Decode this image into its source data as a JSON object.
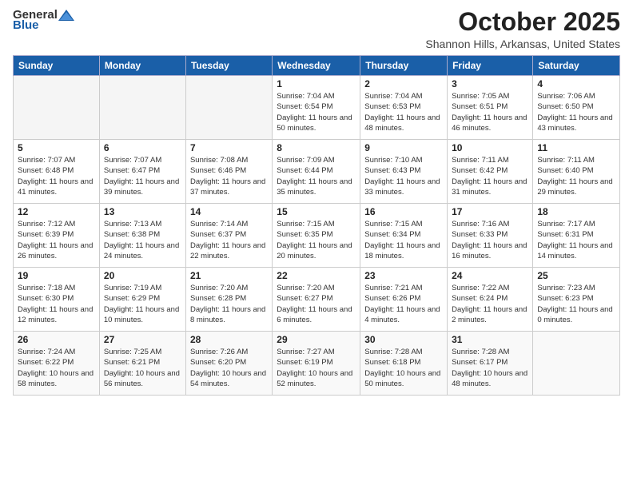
{
  "header": {
    "logo_general": "General",
    "logo_blue": "Blue",
    "month": "October 2025",
    "location": "Shannon Hills, Arkansas, United States"
  },
  "weekdays": [
    "Sunday",
    "Monday",
    "Tuesday",
    "Wednesday",
    "Thursday",
    "Friday",
    "Saturday"
  ],
  "weeks": [
    [
      {
        "day": "",
        "info": ""
      },
      {
        "day": "",
        "info": ""
      },
      {
        "day": "",
        "info": ""
      },
      {
        "day": "1",
        "info": "Sunrise: 7:04 AM\nSunset: 6:54 PM\nDaylight: 11 hours\nand 50 minutes."
      },
      {
        "day": "2",
        "info": "Sunrise: 7:04 AM\nSunset: 6:53 PM\nDaylight: 11 hours\nand 48 minutes."
      },
      {
        "day": "3",
        "info": "Sunrise: 7:05 AM\nSunset: 6:51 PM\nDaylight: 11 hours\nand 46 minutes."
      },
      {
        "day": "4",
        "info": "Sunrise: 7:06 AM\nSunset: 6:50 PM\nDaylight: 11 hours\nand 43 minutes."
      }
    ],
    [
      {
        "day": "5",
        "info": "Sunrise: 7:07 AM\nSunset: 6:48 PM\nDaylight: 11 hours\nand 41 minutes."
      },
      {
        "day": "6",
        "info": "Sunrise: 7:07 AM\nSunset: 6:47 PM\nDaylight: 11 hours\nand 39 minutes."
      },
      {
        "day": "7",
        "info": "Sunrise: 7:08 AM\nSunset: 6:46 PM\nDaylight: 11 hours\nand 37 minutes."
      },
      {
        "day": "8",
        "info": "Sunrise: 7:09 AM\nSunset: 6:44 PM\nDaylight: 11 hours\nand 35 minutes."
      },
      {
        "day": "9",
        "info": "Sunrise: 7:10 AM\nSunset: 6:43 PM\nDaylight: 11 hours\nand 33 minutes."
      },
      {
        "day": "10",
        "info": "Sunrise: 7:11 AM\nSunset: 6:42 PM\nDaylight: 11 hours\nand 31 minutes."
      },
      {
        "day": "11",
        "info": "Sunrise: 7:11 AM\nSunset: 6:40 PM\nDaylight: 11 hours\nand 29 minutes."
      }
    ],
    [
      {
        "day": "12",
        "info": "Sunrise: 7:12 AM\nSunset: 6:39 PM\nDaylight: 11 hours\nand 26 minutes."
      },
      {
        "day": "13",
        "info": "Sunrise: 7:13 AM\nSunset: 6:38 PM\nDaylight: 11 hours\nand 24 minutes."
      },
      {
        "day": "14",
        "info": "Sunrise: 7:14 AM\nSunset: 6:37 PM\nDaylight: 11 hours\nand 22 minutes."
      },
      {
        "day": "15",
        "info": "Sunrise: 7:15 AM\nSunset: 6:35 PM\nDaylight: 11 hours\nand 20 minutes."
      },
      {
        "day": "16",
        "info": "Sunrise: 7:15 AM\nSunset: 6:34 PM\nDaylight: 11 hours\nand 18 minutes."
      },
      {
        "day": "17",
        "info": "Sunrise: 7:16 AM\nSunset: 6:33 PM\nDaylight: 11 hours\nand 16 minutes."
      },
      {
        "day": "18",
        "info": "Sunrise: 7:17 AM\nSunset: 6:31 PM\nDaylight: 11 hours\nand 14 minutes."
      }
    ],
    [
      {
        "day": "19",
        "info": "Sunrise: 7:18 AM\nSunset: 6:30 PM\nDaylight: 11 hours\nand 12 minutes."
      },
      {
        "day": "20",
        "info": "Sunrise: 7:19 AM\nSunset: 6:29 PM\nDaylight: 11 hours\nand 10 minutes."
      },
      {
        "day": "21",
        "info": "Sunrise: 7:20 AM\nSunset: 6:28 PM\nDaylight: 11 hours\nand 8 minutes."
      },
      {
        "day": "22",
        "info": "Sunrise: 7:20 AM\nSunset: 6:27 PM\nDaylight: 11 hours\nand 6 minutes."
      },
      {
        "day": "23",
        "info": "Sunrise: 7:21 AM\nSunset: 6:26 PM\nDaylight: 11 hours\nand 4 minutes."
      },
      {
        "day": "24",
        "info": "Sunrise: 7:22 AM\nSunset: 6:24 PM\nDaylight: 11 hours\nand 2 minutes."
      },
      {
        "day": "25",
        "info": "Sunrise: 7:23 AM\nSunset: 6:23 PM\nDaylight: 11 hours\nand 0 minutes."
      }
    ],
    [
      {
        "day": "26",
        "info": "Sunrise: 7:24 AM\nSunset: 6:22 PM\nDaylight: 10 hours\nand 58 minutes."
      },
      {
        "day": "27",
        "info": "Sunrise: 7:25 AM\nSunset: 6:21 PM\nDaylight: 10 hours\nand 56 minutes."
      },
      {
        "day": "28",
        "info": "Sunrise: 7:26 AM\nSunset: 6:20 PM\nDaylight: 10 hours\nand 54 minutes."
      },
      {
        "day": "29",
        "info": "Sunrise: 7:27 AM\nSunset: 6:19 PM\nDaylight: 10 hours\nand 52 minutes."
      },
      {
        "day": "30",
        "info": "Sunrise: 7:28 AM\nSunset: 6:18 PM\nDaylight: 10 hours\nand 50 minutes."
      },
      {
        "day": "31",
        "info": "Sunrise: 7:28 AM\nSunset: 6:17 PM\nDaylight: 10 hours\nand 48 minutes."
      },
      {
        "day": "",
        "info": ""
      }
    ]
  ]
}
